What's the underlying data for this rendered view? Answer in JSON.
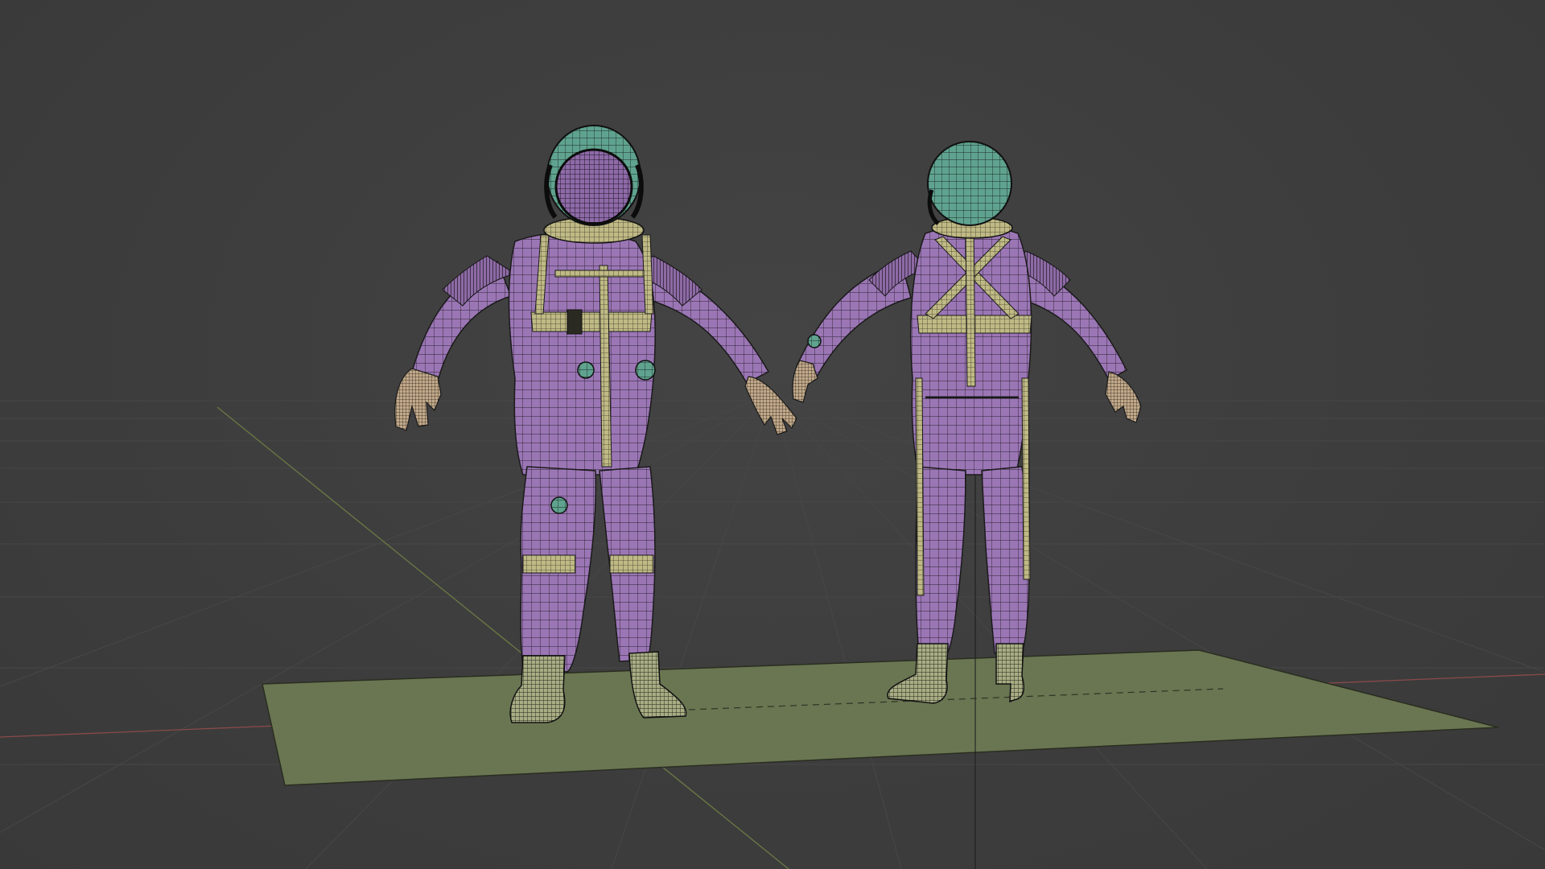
{
  "viewport": {
    "view": "3D Viewport",
    "shading": "wireframe-overlay",
    "colors": {
      "background": "#3d3d3d",
      "grid_line": "#4a4a4a",
      "x_axis": "#8a4a4a",
      "y_axis": "#6b7a45",
      "ground_plane": "#6a7652",
      "suit": "#9b76b5",
      "helmet": "#5fa38f",
      "straps": "#b6b07e",
      "boots": "#a8ad84",
      "wire": "#1f1f1f"
    }
  },
  "scene": {
    "objects": [
      {
        "name": "astronaut-front",
        "view": "front"
      },
      {
        "name": "astronaut-back",
        "view": "back"
      },
      {
        "name": "ground-plane",
        "view": "plane"
      }
    ]
  }
}
